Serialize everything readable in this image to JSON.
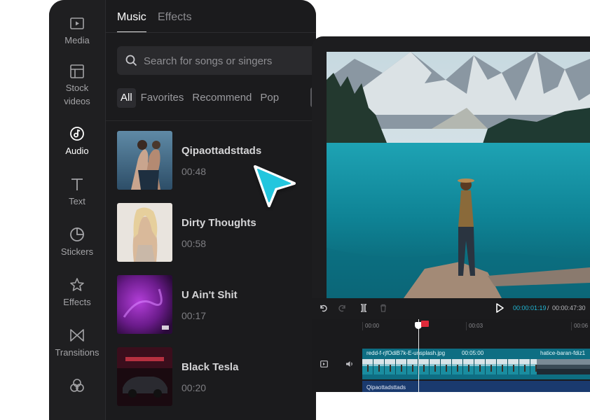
{
  "sidebar": {
    "items": [
      {
        "label": "Media",
        "icon": "media-icon"
      },
      {
        "label": "Stock\nvideos",
        "icon": "stock-videos-icon"
      },
      {
        "label": "Audio",
        "icon": "audio-icon",
        "active": true
      },
      {
        "label": "Text",
        "icon": "text-icon"
      },
      {
        "label": "Stickers",
        "icon": "stickers-icon"
      },
      {
        "label": "Effects",
        "icon": "effects-icon"
      },
      {
        "label": "Transitions",
        "icon": "transitions-icon"
      }
    ]
  },
  "library": {
    "tabs": [
      "Music",
      "Effects"
    ],
    "active_tab": "Music",
    "search": {
      "placeholder": "Search for songs or singers",
      "value": ""
    },
    "filters": [
      "All",
      "Favorites",
      "Recommend",
      "Pop"
    ],
    "active_filter": "All",
    "tracks": [
      {
        "title": "Qipaottadsttads",
        "duration": "00:48"
      },
      {
        "title": "Dirty Thoughts",
        "duration": "00:58"
      },
      {
        "title": "U Ain't Shit",
        "duration": "00:17"
      },
      {
        "title": "Black Tesla",
        "duration": "00:20"
      }
    ]
  },
  "editor": {
    "controls": {
      "current_time": "00:00:01:19",
      "separator": "/",
      "total_time": "00:00:47:30"
    },
    "timeline": {
      "ticks": [
        "00:00",
        "00:03",
        "00:06"
      ],
      "video_clip": {
        "name": "redd-f-rjfOdiB7k-E-unsplash.jpg",
        "duration": "00:05:00",
        "next_clip": "hatice-baran-fdiz1"
      },
      "audio_clip": {
        "name": "Qipaottadsttads"
      }
    }
  },
  "colors": {
    "accent": "#20b8d6",
    "panel_bg": "#1f1f21",
    "video_track": "#0e6e83",
    "audio_track": "#1a3a6e",
    "marker": "#e02a3a"
  }
}
